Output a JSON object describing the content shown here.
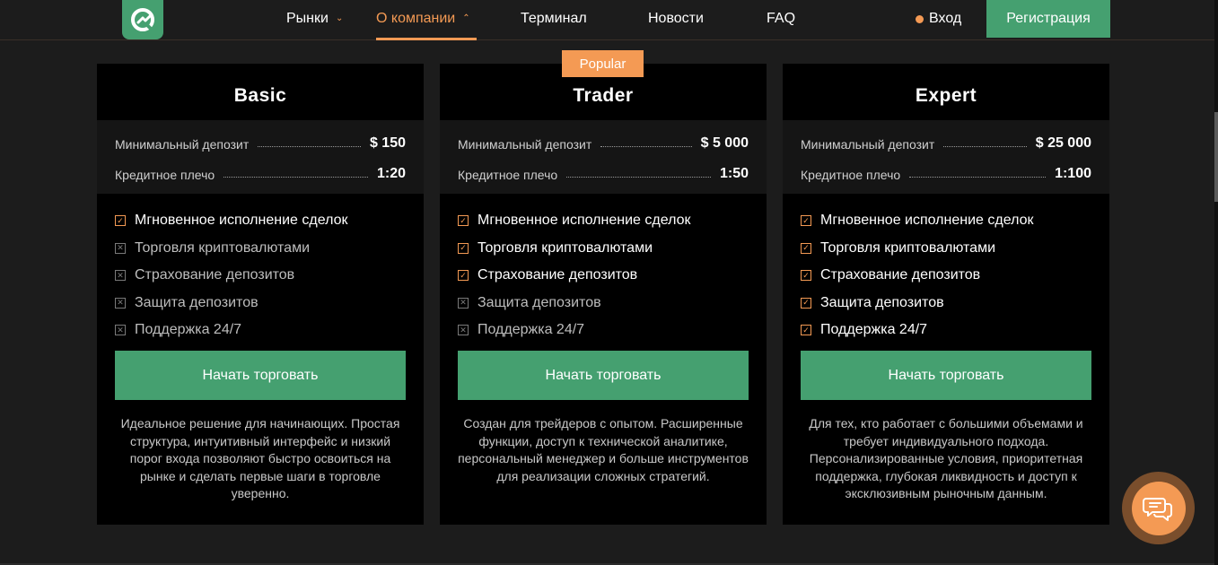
{
  "header": {
    "nav": [
      {
        "label": "Рынки",
        "has_chevron": true,
        "active": false
      },
      {
        "label": "О компании",
        "has_chevron": true,
        "active": true
      },
      {
        "label": "Терминал",
        "has_chevron": false,
        "active": false
      },
      {
        "label": "Новости",
        "has_chevron": false,
        "active": false
      },
      {
        "label": "FAQ",
        "has_chevron": false,
        "active": false
      }
    ],
    "login_label": "Вход",
    "register_label": "Регистрация"
  },
  "colors": {
    "accent_orange": "#f49a54",
    "accent_green": "#45a070",
    "card_bg": "#000000",
    "page_bg": "#1c1c1c"
  },
  "badge_label": "Popular",
  "plans": [
    {
      "name": "Basic",
      "specs": [
        {
          "label": "Минимальный депозит",
          "value": "$ 150"
        },
        {
          "label": "Кредитное плечо",
          "value": "1:20"
        }
      ],
      "features": [
        {
          "label": "Мгновенное исполнение сделок",
          "included": true
        },
        {
          "label": "Торговля криптовалютами",
          "included": false
        },
        {
          "label": "Страхование депозитов",
          "included": false
        },
        {
          "label": "Защита депозитов",
          "included": false
        },
        {
          "label": "Поддержка 24/7",
          "included": false
        }
      ],
      "cta_label": "Начать торговать",
      "description": "Идеальное решение для начинающих. Простая структура, интуитивный интерфейс и низкий порог входа позволяют быстро освоиться на рынке и сделать первые шаги в торговле уверенно."
    },
    {
      "name": "Trader",
      "specs": [
        {
          "label": "Минимальный депозит",
          "value": "$ 5 000"
        },
        {
          "label": "Кредитное плечо",
          "value": "1:50"
        }
      ],
      "features": [
        {
          "label": "Мгновенное исполнение сделок",
          "included": true
        },
        {
          "label": "Торговля криптовалютами",
          "included": true
        },
        {
          "label": "Страхование депозитов",
          "included": true
        },
        {
          "label": "Защита депозитов",
          "included": false
        },
        {
          "label": "Поддержка 24/7",
          "included": false
        }
      ],
      "cta_label": "Начать торговать",
      "description": "Создан для трейдеров с опытом. Расширенные функции, доступ к технической аналитике, персональный менеджер и больше инструментов для реализации сложных стратегий."
    },
    {
      "name": "Expert",
      "specs": [
        {
          "label": "Минимальный депозит",
          "value": "$ 25 000"
        },
        {
          "label": "Кредитное плечо",
          "value": "1:100"
        }
      ],
      "features": [
        {
          "label": "Мгновенное исполнение сделок",
          "included": true
        },
        {
          "label": "Торговля криптовалютами",
          "included": true
        },
        {
          "label": "Страхование депозитов",
          "included": true
        },
        {
          "label": "Защита депозитов",
          "included": true
        },
        {
          "label": "Поддержка 24/7",
          "included": true
        }
      ],
      "cta_label": "Начать торговать",
      "description": "Для тех, кто работает с большими объемами и требует индивидуального подхода. Персонализированные условия, приоритетная поддержка, глубокая ликвидность и доступ к эксклюзивным рыночным данным."
    }
  ],
  "icons": {
    "logo": "logo-icon",
    "chat": "chat-bubbles-icon",
    "check": "check-icon",
    "cross": "cross-icon",
    "chevron": "chevron-down-icon"
  }
}
